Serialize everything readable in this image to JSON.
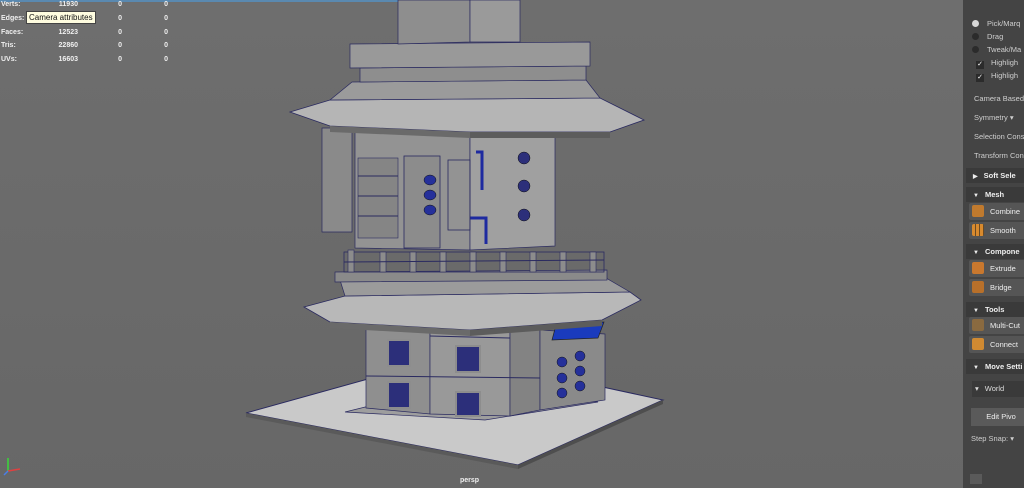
{
  "hud": {
    "rows": [
      {
        "label": "Verts:",
        "v1": "11930",
        "v2": "0",
        "v3": "0"
      },
      {
        "label": "Edges:",
        "v1": "",
        "v2": "0",
        "v3": "0"
      },
      {
        "label": "Faces:",
        "v1": "12523",
        "v2": "0",
        "v3": "0"
      },
      {
        "label": "Tris:",
        "v1": "22860",
        "v2": "0",
        "v3": "0"
      },
      {
        "label": "UVs:",
        "v1": "16603",
        "v2": "0",
        "v3": "0"
      }
    ],
    "tooltip": "Camera attributes"
  },
  "viewport": {
    "camera_label": "persp"
  },
  "panel": {
    "pick_options": [
      {
        "label": "Pick/Marq",
        "type": "radio",
        "selected": true
      },
      {
        "label": "Drag",
        "type": "radio",
        "selected": false
      },
      {
        "label": "Tweak/Ma",
        "type": "radio",
        "selected": false
      },
      {
        "label": "Highligh",
        "type": "check",
        "checked": true
      },
      {
        "label": "Highligh",
        "type": "check",
        "checked": true
      }
    ],
    "camera_based": "Camera Based",
    "symmetry": "Symmetry",
    "selection_constraint": "Selection Cons",
    "transform_constraint": "Transform Con",
    "soft_select": "Soft Sele",
    "mesh_header": "Mesh",
    "combine": "Combine",
    "smooth": "Smooth",
    "components_header": "Compone",
    "extrude": "Extrude",
    "bridge": "Bridge",
    "tools_header": "Tools",
    "multi_cut": "Multi-Cut",
    "connect": "Connect",
    "move_settings_header": "Move Setti",
    "world": "World",
    "edit_pivot": "Edit Pivo",
    "step_snap": "Step Snap:"
  },
  "colors": {
    "viewport_bg": "#6a6a6a",
    "panel_bg": "#444444",
    "model_gray": "#8a8a8a",
    "wire_blue": "#1e2a9e"
  },
  "icons": [
    "combine-icon",
    "smooth-icon",
    "extrude-icon",
    "bridge-icon",
    "multi-cut-icon",
    "connect-icon",
    "axis-icon"
  ]
}
